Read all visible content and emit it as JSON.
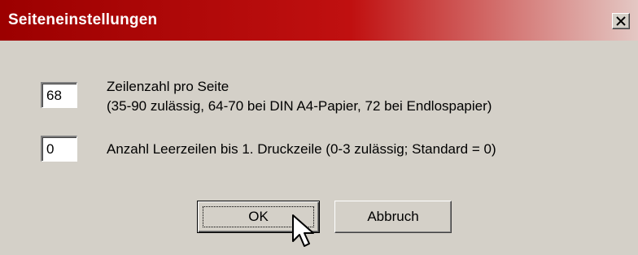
{
  "window": {
    "title": "Seiteneinstellungen",
    "close_icon": "close-icon"
  },
  "lines_per_page": {
    "value": "68",
    "label_line1": "Zeilenzahl pro Seite",
    "label_line2": "(35-90 zulässig, 64-70 bei DIN A4-Papier, 72 bei Endlospapier)"
  },
  "blank_lines": {
    "value": "0",
    "label": "Anzahl Leerzeilen bis 1. Druckzeile (0-3 zulässig; Standard = 0)"
  },
  "buttons": {
    "ok_label": "OK",
    "cancel_label": "Abbruch"
  },
  "colors": {
    "title_bar_start": "#9c0000",
    "title_bar_end": "#e4c8c4",
    "dialog_face": "#d4d0c8"
  }
}
